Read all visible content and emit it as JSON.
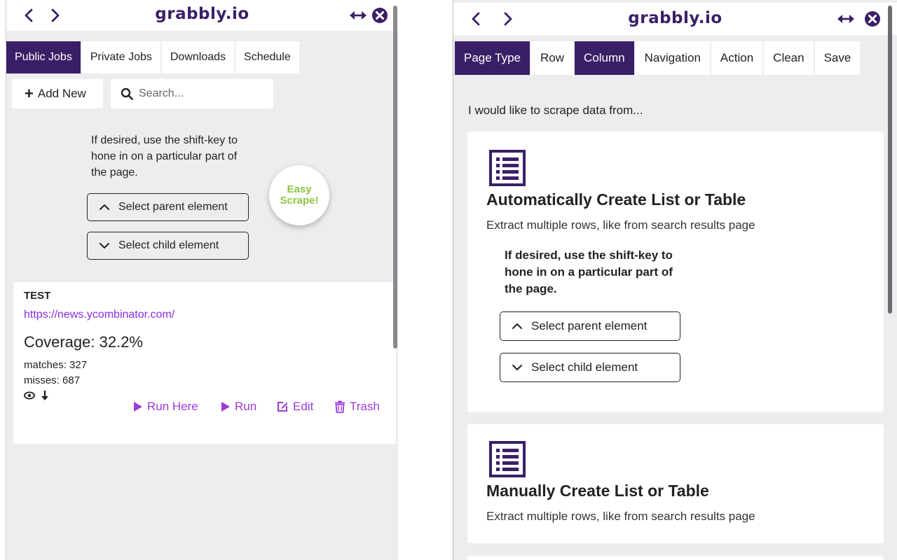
{
  "brand": {
    "name": "grabbly.io",
    "color": "#3b1f66",
    "accent": "#9b3bd8",
    "easy_color": "#8bc53f"
  },
  "left": {
    "tabs": [
      {
        "label": "Public Jobs",
        "active": true
      },
      {
        "label": "Private Jobs",
        "active": false
      },
      {
        "label": "Downloads",
        "active": false
      },
      {
        "label": "Schedule",
        "active": false
      }
    ],
    "add_new_label": "Add New",
    "search": {
      "placeholder": "Search...",
      "value": ""
    },
    "hint": "If desired, use the shift-key to hone in on a particular part of the page.",
    "select_parent": "Select parent element",
    "select_child": "Select child element",
    "easy_scrape": "Easy Scrape!",
    "job": {
      "name": "TEST",
      "url": "https://news.ycombinator.com/",
      "coverage": "Coverage: 32.2%",
      "matches": "matches: 327",
      "misses": "misses: 687",
      "actions": {
        "run_here": "Run Here",
        "run": "Run",
        "edit": "Edit",
        "trash": "Trash"
      }
    }
  },
  "right": {
    "tabs": [
      {
        "label": "Page Type",
        "active": true
      },
      {
        "label": "Row",
        "active": false
      },
      {
        "label": "Column",
        "active": true
      },
      {
        "label": "Navigation",
        "active": false
      },
      {
        "label": "Action",
        "active": false
      },
      {
        "label": "Clean",
        "active": false
      },
      {
        "label": "Save",
        "active": false
      }
    ],
    "prompt": "I would like to scrape data from...",
    "options": {
      "auto": {
        "title": "Automatically Create List or Table",
        "desc": "Extract multiple rows, like from search results page",
        "hint": "If desired, use the shift-key to hone in on a particular part of the page.",
        "select_parent": "Select parent element",
        "select_child": "Select child element"
      },
      "manual": {
        "title": "Manually Create List or Table",
        "desc": "Extract multiple rows, like from search results page"
      }
    }
  },
  "icons": [
    "chevron-left-icon",
    "chevron-right-icon",
    "resize-horizontal-icon",
    "close-circle-icon",
    "plus-icon",
    "search-icon",
    "chevron-up-icon",
    "chevron-down-icon",
    "eye-icon",
    "download-arrow-icon",
    "play-icon",
    "edit-icon",
    "trash-icon",
    "list-icon"
  ]
}
